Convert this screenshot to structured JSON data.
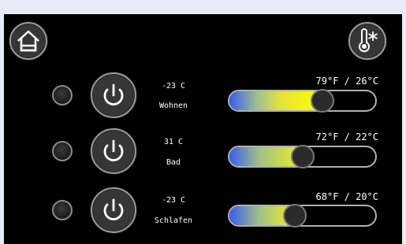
{
  "header": {
    "home_icon": "home-icon",
    "climate_icon": "thermometer-snowflake-icon"
  },
  "rooms": [
    {
      "name": "Wohnen",
      "status": "-23 C",
      "temp_display": "79°F / 26°C",
      "level": 0.64,
      "gradient": "linear-gradient(90deg, #3a5cf0 0%, #9ec090 30%, #e6e23a 55%, #ffff00 100%)"
    },
    {
      "name": "Bad",
      "status": "31 C",
      "temp_display": "72°F / 22°C",
      "level": 0.5,
      "gradient": "linear-gradient(90deg, #3a5cf0 0%, #a0c088 40%, #eef024 100%)"
    },
    {
      "name": "Schlafen",
      "status": "-23 C",
      "temp_display": "68°F / 20°C",
      "level": 0.45,
      "gradient": "linear-gradient(90deg, #3a5cf0 0%, #a0c088 45%, #eef024 100%)"
    }
  ],
  "colors": {
    "background": "#000000",
    "text": "#ffffff",
    "outer_frame": "#e8ecf8"
  }
}
